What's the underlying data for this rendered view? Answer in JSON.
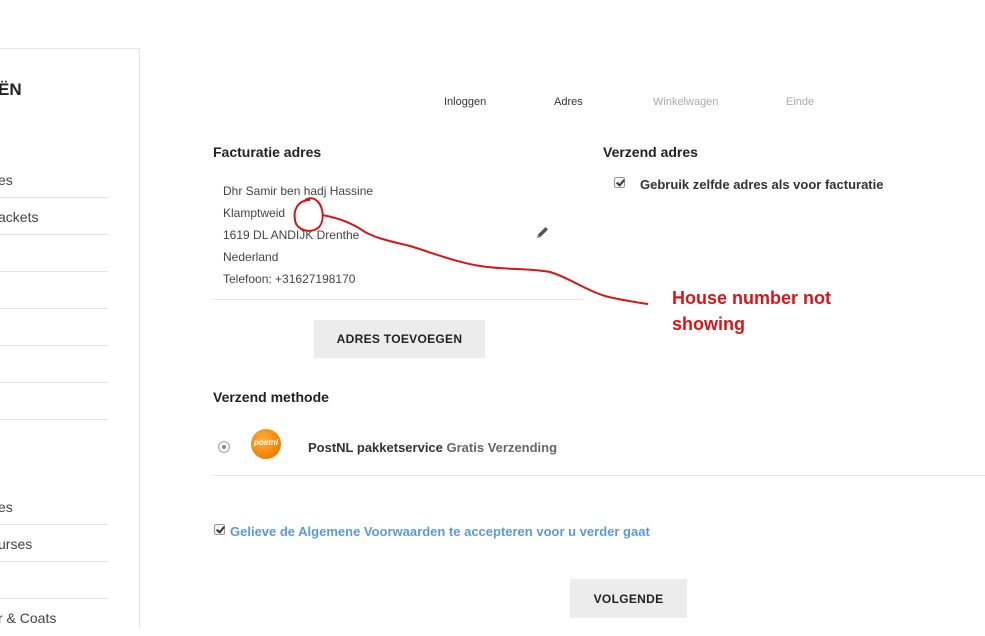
{
  "sidebar": {
    "title": "ËN",
    "items": [
      "es",
      "ackets",
      "",
      "",
      "",
      "",
      "",
      "es",
      "urses",
      "",
      "r & Coats"
    ]
  },
  "steps": [
    "Inloggen",
    "Adres",
    "Winkelwagen",
    "Einde"
  ],
  "billing": {
    "heading": "Facturatie adres",
    "lines": [
      "Dhr Samir ben hadj Hassine",
      "Klamptweid",
      "1619 DL ANDIJK Drenthe",
      "Nederland",
      "Telefoon: +31627198170"
    ],
    "add_button": "ADRES TOEVOEGEN",
    "edit_icon": "pencil-icon"
  },
  "shipping_address": {
    "heading": "Verzend adres",
    "same_as_billing_label": "Gebruik zelfde adres als voor facturatie",
    "checked": true
  },
  "shipping_method": {
    "heading": "Verzend methode",
    "option_name": "PostNL pakketservice",
    "option_price": "Gratis Verzending",
    "logo_text": "postnl"
  },
  "terms": {
    "label": "Gelieve de Algemene Voorwaarden te accepteren voor u verder gaat",
    "checked": true
  },
  "next_button": "VOLGENDE",
  "annotation": {
    "text_line1": "House number not",
    "text_line2": "showing",
    "color": "#d7161a"
  }
}
